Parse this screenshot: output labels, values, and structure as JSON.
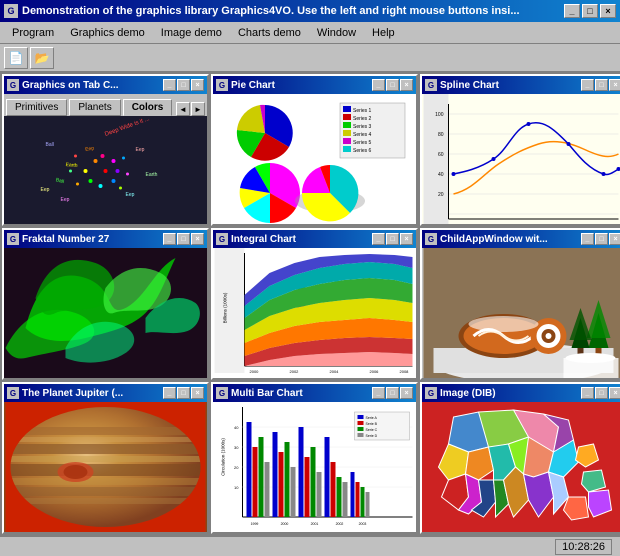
{
  "app": {
    "title": "Demonstration of the graphics library Graphics4VO. Use the left and right mouse buttons insi...",
    "icon": "G"
  },
  "menu": {
    "items": [
      "Program",
      "Graphics demo",
      "Image demo",
      "Charts demo",
      "Window",
      "Help"
    ]
  },
  "toolbar": {
    "buttons": [
      "📄",
      "📂"
    ]
  },
  "windows": {
    "graphics": {
      "title": "Graphics on Tab C...",
      "tabs": [
        "Primitives",
        "Planets",
        "Colors"
      ],
      "active_tab": "Colors"
    },
    "pie": {
      "title": "Pie Chart"
    },
    "spline": {
      "title": "Spline Chart"
    },
    "fractal": {
      "title": "Fraktal Number 27"
    },
    "integral": {
      "title": "Integral Chart"
    },
    "childapp": {
      "title": "ChildAppWindow wit..."
    },
    "jupiter": {
      "title": "The Planet Jupiter (..."
    },
    "multibar": {
      "title": "Multi Bar Chart"
    },
    "image": {
      "title": "Image (DIB)"
    }
  },
  "status": {
    "time": "10:28:26"
  },
  "child_window_buttons": {
    "minimize": "_",
    "maximize": "□",
    "close": "×"
  }
}
